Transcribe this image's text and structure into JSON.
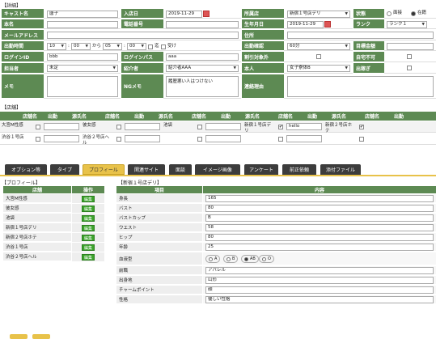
{
  "detail": {
    "title": "【詳細】",
    "cast_name_label": "キャスト名",
    "cast_name": "唐子",
    "join_date_label": "入店日",
    "join_date": "2019-11-29",
    "store_label": "所属店",
    "store": "新宿１号店デリ",
    "status_label": "状態",
    "status_options": [
      "面接",
      "在籍"
    ],
    "real_name_label": "本名",
    "phone_label": "電話番号",
    "birthday_label": "生年月日",
    "birthday": "2019-11-29",
    "rank_label": "ランク",
    "rank": "ランク１",
    "mail_label": "メールアドレス",
    "address_label": "住所",
    "work_time_label": "出勤時間",
    "time_h1": "10",
    "time_m1": "00",
    "time_kara": "から",
    "time_h2": "05",
    "time_m2": "00",
    "time_made": "迄",
    "time_uke": "受け",
    "work_confirm_label": "出勤確認",
    "work_confirm": "60分",
    "goal_label": "目標金額",
    "login_id_label": "ログインID",
    "login_id": "bbb",
    "login_pass_label": "ログインパス",
    "login_pass": "aaa",
    "discount_label": "割引対象外",
    "home_label": "自宅不可",
    "staff_label": "担当者",
    "staff": "未定",
    "intro_label": "紹介者",
    "intro": "紹介者AAA",
    "tax_label": "本人",
    "tax": "女子寮体B",
    "go_label": "出稼ぎ",
    "memo_label": "メモ",
    "ng_memo_label": "NGメモ",
    "ng_memo": "履歴悪い人はつけない",
    "contact_label": "連絡理由"
  },
  "stores": {
    "title": "【店舗】",
    "headers": [
      "店舗名",
      "出勤",
      "源氏名",
      "店舗名",
      "出勤",
      "源氏名",
      "店舗名",
      "出勤",
      "源氏名",
      "店舗名",
      "出勤",
      "源氏名",
      "店舗名",
      "出勤"
    ],
    "rows": [
      [
        "大宮M性感",
        "",
        "",
        "彼女感",
        "",
        "",
        "池袋",
        "",
        "",
        "新宿１号店デリ",
        "✔",
        "hello",
        "新宿２号店ホテ",
        "✔"
      ],
      [
        "渋谷１号店",
        "",
        "",
        "渋谷２号店ヘル",
        "",
        "",
        "",
        "",
        "",
        "",
        "",
        "",
        "",
        ""
      ]
    ]
  },
  "tabs": [
    "オプション等",
    "タイプ",
    "プロフィール",
    "関連サイト",
    "面談",
    "イメージ画像",
    "アンケート",
    "前正依頼",
    "添付ファイル"
  ],
  "profile": {
    "title": "【プロフィール】",
    "col_store": "店舗",
    "col_op": "操作",
    "edit": "編集",
    "stores": [
      "大宮M性感",
      "彼女感",
      "池袋",
      "新宿１号店デリ",
      "新宿２号店ホテ",
      "渋谷１号店",
      "渋谷２号店ヘル"
    ]
  },
  "shop_profile": {
    "title": "【新宿１号店デリ】",
    "col_item": "項目",
    "col_content": "内容",
    "rows": [
      [
        "身長",
        "165"
      ],
      [
        "バスト",
        "80"
      ],
      [
        "バストカップ",
        "B"
      ],
      [
        "ウエスト",
        "58"
      ],
      [
        "ヒップ",
        "80"
      ],
      [
        "年齢",
        "25"
      ],
      [
        "血液型",
        ""
      ],
      [
        "前職",
        "アパレル"
      ],
      [
        "出身地",
        "山形"
      ],
      [
        "チャームポイント",
        "顔"
      ],
      [
        "性格",
        "優しい性格"
      ]
    ],
    "blood": [
      "A",
      "B",
      "AB",
      "O"
    ]
  },
  "colors": {
    "green": "#5d8a53",
    "tab_active": "#e8c24a",
    "edit_btn": "#3aa32a"
  }
}
